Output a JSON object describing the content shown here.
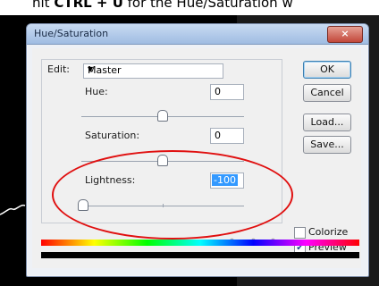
{
  "banner": {
    "prefix": "hit ",
    "shortcut": "CTRL + U",
    "suffix": " for the Hue/Saturation w"
  },
  "dialog": {
    "title": "Hue/Saturation",
    "close_symbol": "×",
    "edit_label": "Edit:",
    "edit_value": "Master",
    "hue_label": "Hue:",
    "hue_value": "0",
    "saturation_label": "Saturation:",
    "saturation_value": "0",
    "lightness_label": "Lightness:",
    "lightness_value": "-100",
    "buttons": {
      "ok": "OK",
      "cancel": "Cancel",
      "load": "Load...",
      "save": "Save..."
    },
    "colorize_label": "Colorize",
    "preview_label": "Preview",
    "colorize_checked": false,
    "preview_checked": true
  },
  "icons": [
    "dropdown-arrow-icon",
    "eyedropper-icon",
    "eyedropper-plus-icon",
    "eyedropper-minus-icon",
    "close-icon",
    "check-icon"
  ],
  "colors": {
    "highlight_ring": "#e01010",
    "selection": "#3399ff"
  }
}
